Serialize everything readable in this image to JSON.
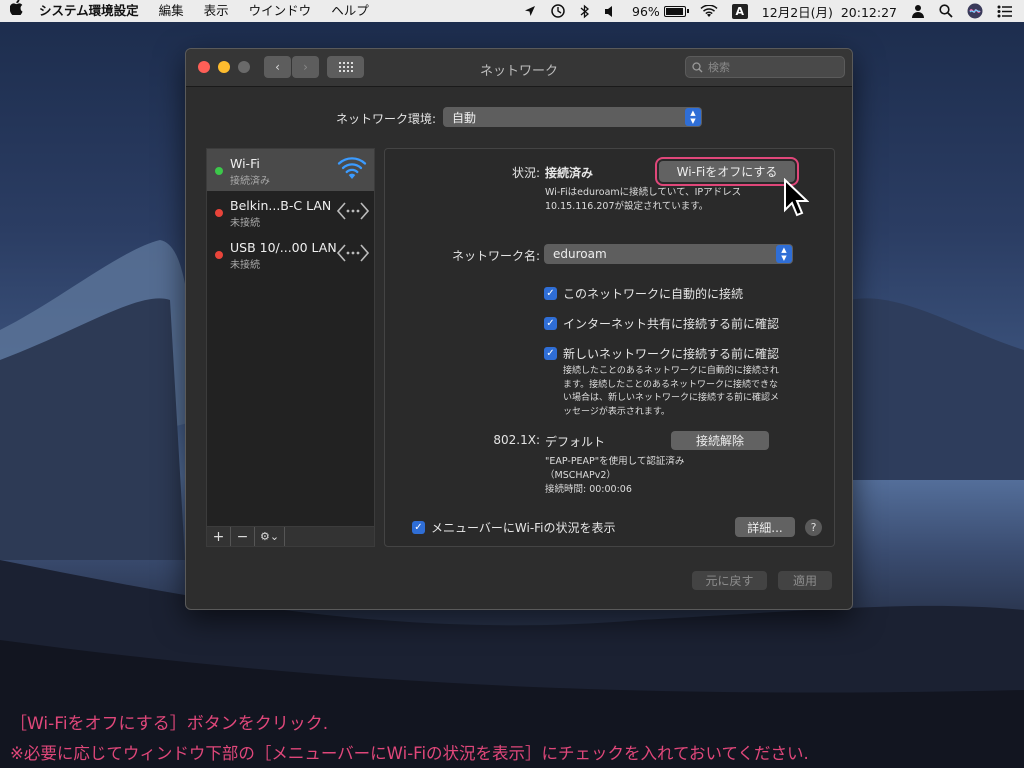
{
  "menubar": {
    "apple": "",
    "items": [
      "システム環境設定",
      "編集",
      "表示",
      "ウインドウ",
      "ヘルプ"
    ],
    "battery": "96%",
    "ime": "A",
    "clock": "12月2日(月)  20:12:27"
  },
  "window": {
    "title": "ネットワーク",
    "search_placeholder": "検索",
    "location_label": "ネットワーク環境:",
    "location_value": "自動",
    "services": [
      {
        "name": "Wi-Fi",
        "status": "接続済み",
        "dot": "#3cc84a",
        "icon": "wifi-icon"
      },
      {
        "name": "Belkin...B-C LAN",
        "status": "未接続",
        "dot": "#e8443a",
        "icon": "ethernet-icon"
      },
      {
        "name": "USB 10/...00 LAN",
        "status": "未接続",
        "dot": "#e8443a",
        "icon": "ethernet-icon"
      }
    ],
    "detail": {
      "status_label": "状況:",
      "status_value": "接続済み",
      "wifi_off_button": "Wi-Fiをオフにする",
      "status_desc_1": "Wi-Fiはeduroamに接続していて、IPアドレス",
      "status_desc_2": "10.15.116.207が設定されています。",
      "network_name_label": "ネットワーク名:",
      "network_name_value": "eduroam",
      "checkboxes": [
        "このネットワークに自動的に接続",
        "インターネット共有に接続する前に確認",
        "新しいネットワークに接続する前に確認"
      ],
      "note_lines": [
        "接続したことのあるネットワークに自動的に接続され",
        "ます。接続したことのあるネットワークに接続できな",
        "い場合は、新しいネットワークに接続する前に確認メ",
        "ッセージが表示されます。"
      ],
      "dot1x_label": "802.1X:",
      "dot1x_value": "デフォルト",
      "disconnect_button": "接続解除",
      "eap_line1": "\"EAP-PEAP\"を使用して認証済み",
      "eap_line2": "（MSCHAPv2）",
      "connect_time": "接続時間: 00:00:06",
      "menubar_checkbox": "メニューバーにWi-Fiの状況を表示",
      "advanced_button": "詳細...",
      "help_button": "?"
    },
    "revert_button": "元に戻す",
    "apply_button": "適用"
  },
  "caption": {
    "line1": "［Wi-Fiをオフにする］ボタンをクリック.",
    "line2": "※必要に応じてウィンドウ下部の［メニューバーにWi-Fiの状況を表示］にチェックを入れておいてください."
  },
  "colors": {
    "accent": "#2f6ed6",
    "highlight": "#e0477a"
  }
}
